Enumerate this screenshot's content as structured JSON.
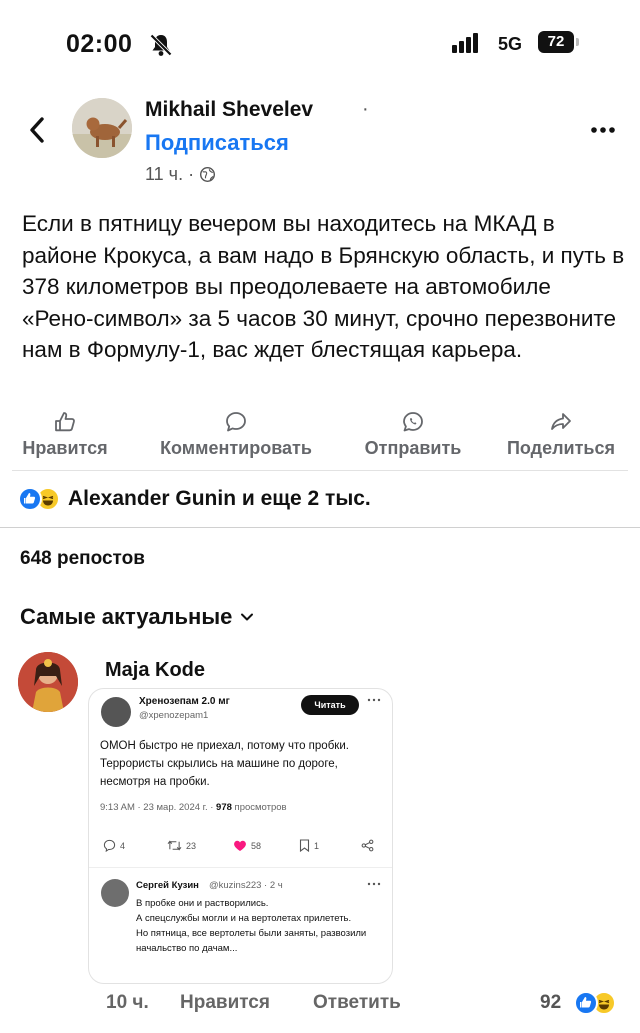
{
  "status_bar": {
    "time": "02:00",
    "network": "5G",
    "battery": "72"
  },
  "post": {
    "author": "Mikhail Shevelev",
    "author_separator": "·",
    "subscribe_label": "Подписаться",
    "time_ago": "11 ч.",
    "meta_separator": "·",
    "text": "Если в пятницу вечером вы находитесь на МКАД в районе Крокуса, а вам надо в Брянскую область, и путь в 378 километров вы преодолеваете на автомобиле «Рено-символ» за 5 часов 30 минут, срочно перезвоните нам в Формулу-1, вас ждет блестящая карьера."
  },
  "actions": {
    "like": "Нравится",
    "comment": "Комментировать",
    "send": "Отправить",
    "share": "Поделиться"
  },
  "reactions": {
    "summary": "Alexander Gunin и еще 2 тыс."
  },
  "reposts": "648 репостов",
  "sort": {
    "label": "Самые актуальные"
  },
  "comment": {
    "author": "Maja Kode",
    "time_ago": "10 ч.",
    "like_label": "Нравится",
    "reply_label": "Ответить",
    "reaction_count": "92",
    "embedded_tweet": {
      "author": "Хренозепам 2.0 мг",
      "handle": "@xpenozepam1",
      "follow_label": "Читать",
      "text": "ОМОН быстро не приехал, потому что пробки. Террористы скрылись на машине по дороге, несмотря на пробки.",
      "time_date": "9:13 AM · 23 мар. 2024 г. ·",
      "views_count": "978",
      "views_label": "просмотров",
      "stats": {
        "replies": "4",
        "retweets": "23",
        "likes": "58",
        "bookmarks": "1"
      },
      "reply": {
        "author": "Сергей Кузин",
        "handle": "@kuzins223 · 2 ч",
        "text_lines": [
          "В пробке они и растворились.",
          "А спецслужбы могли и на вертолетах прилететь.",
          "Но пятница, все вертолеты были заняты, развозили начальство по дачам..."
        ]
      }
    }
  },
  "colors": {
    "accent": "#1877f2",
    "secondary_text": "#65676b",
    "haha_reaction": "#f7c928",
    "like_heart": "#f91880"
  }
}
